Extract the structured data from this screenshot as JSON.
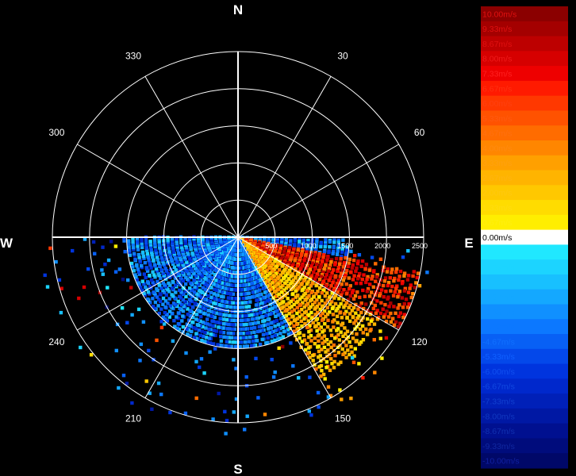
{
  "chart_data": {
    "type": "polar-radar",
    "title": "",
    "compass_labels": {
      "north": "N",
      "east": "E",
      "south": "S",
      "west": "W"
    },
    "bearing_labels": [
      {
        "deg": 30,
        "text": "30"
      },
      {
        "deg": 60,
        "text": "60"
      },
      {
        "deg": 120,
        "text": "120"
      },
      {
        "deg": 150,
        "text": "150"
      },
      {
        "deg": 210,
        "text": "210"
      },
      {
        "deg": 240,
        "text": "240"
      },
      {
        "deg": 300,
        "text": "300"
      },
      {
        "deg": 330,
        "text": "330"
      }
    ],
    "range_rings": [
      500,
      1000,
      1500,
      2000,
      2500
    ],
    "range_labels": [
      "500",
      "1000",
      "1500",
      "2000",
      "2500"
    ],
    "range_max": 2500,
    "spoke_interval_deg": 30,
    "data_sector_deg": [
      90,
      270
    ],
    "sector_summary": [
      {
        "bearing_from": 100,
        "bearing_to": 120,
        "velocity_range": [
          4.0,
          9.33
        ],
        "range_to": 2500
      },
      {
        "bearing_from": 120,
        "bearing_to": 150,
        "velocity_range": [
          0.67,
          4.67
        ],
        "range_to": 2200
      },
      {
        "bearing_from": 150,
        "bearing_to": 270,
        "velocity_range": [
          -6.67,
          -1.33
        ],
        "range_to": 1500
      }
    ],
    "colorscale": {
      "unit": "m/s",
      "entries": [
        {
          "value": 10.0,
          "label": "10.00m/s",
          "color": "#8b0000",
          "text_color": "#e01010"
        },
        {
          "value": 9.33,
          "label": "9.33m/s",
          "color": "#a40000",
          "text_color": "#e01010"
        },
        {
          "value": 8.67,
          "label": "8.67m/s",
          "color": "#bd0000",
          "text_color": "#e01010"
        },
        {
          "value": 8.0,
          "label": "8.00m/s",
          "color": "#d60000",
          "text_color": "#f01a1a"
        },
        {
          "value": 7.33,
          "label": "7.33m/s",
          "color": "#ee0000",
          "text_color": "#ff2020"
        },
        {
          "value": 6.67,
          "label": "6.67m/s",
          "color": "#ff1a00",
          "text_color": "#ff3010"
        },
        {
          "value": 6.0,
          "label": "6.00m/s",
          "color": "#ff3800",
          "text_color": "#ff4010"
        },
        {
          "value": 5.33,
          "label": "5.33m/s",
          "color": "#ff5200",
          "text_color": "#ff5a10"
        },
        {
          "value": 4.67,
          "label": "4.67m/s",
          "color": "#ff6c00",
          "text_color": "#ff7010"
        },
        {
          "value": 4.0,
          "label": "4.00m/s",
          "color": "#ff8600",
          "text_color": "#ff8a10"
        },
        {
          "value": 3.33,
          "label": "3.33m/s",
          "color": "#ffa000",
          "text_color": "#ffa010"
        },
        {
          "value": 2.67,
          "label": "2.67m/s",
          "color": "#ffb400",
          "text_color": "#ffb410"
        },
        {
          "value": 2.0,
          "label": "2.00m/s",
          "color": "#ffc800",
          "text_color": "#ffc810"
        },
        {
          "value": 1.33,
          "label": "1.33m/s",
          "color": "#ffdc00",
          "text_color": "#ffdc10"
        },
        {
          "value": 0.67,
          "label": "0.67m/s",
          "color": "#ffee00",
          "text_color": "#ffee10"
        },
        {
          "value": 0.0,
          "label": "0.00m/s",
          "color": "#ffffff",
          "text_color": "#ffffff"
        },
        {
          "value": -0.67,
          "label": "-0.67m/s",
          "color": "#20e8ff",
          "text_color": "#20e8ff"
        },
        {
          "value": -1.33,
          "label": "-1.33m/s",
          "color": "#1cd4ff",
          "text_color": "#1cd4ff"
        },
        {
          "value": -2.0,
          "label": "-2.00m/s",
          "color": "#18c0ff",
          "text_color": "#18c0ff"
        },
        {
          "value": -2.67,
          "label": "-2.67m/s",
          "color": "#14a8ff",
          "text_color": "#14a8ff"
        },
        {
          "value": -3.33,
          "label": "-3.33m/s",
          "color": "#1090ff",
          "text_color": "#1090ff"
        },
        {
          "value": -4.0,
          "label": "-4.00m/s",
          "color": "#0c78ff",
          "text_color": "#0c78ff"
        },
        {
          "value": -4.67,
          "label": "-4.67m/s",
          "color": "#0860f5",
          "text_color": "#1070ff"
        },
        {
          "value": -5.33,
          "label": "-5.33m/s",
          "color": "#0448ea",
          "text_color": "#1060ff"
        },
        {
          "value": -6.0,
          "label": "-6.00m/s",
          "color": "#0034de",
          "text_color": "#1050f0"
        },
        {
          "value": -6.67,
          "label": "-6.67m/s",
          "color": "#0028cc",
          "text_color": "#1048e0"
        },
        {
          "value": -7.33,
          "label": "-7.33m/s",
          "color": "#0020b8",
          "text_color": "#1040d0"
        },
        {
          "value": -8.0,
          "label": "-8.00m/s",
          "color": "#0018a4",
          "text_color": "#1038c0"
        },
        {
          "value": -8.67,
          "label": "-8.67m/s",
          "color": "#001090",
          "text_color": "#1030b0"
        },
        {
          "value": -9.33,
          "label": "-9.33m/s",
          "color": "#000c7c",
          "text_color": "#1028a0"
        },
        {
          "value": -10.0,
          "label": "-10.00m/s",
          "color": "#000868",
          "text_color": "#1020a0"
        }
      ]
    }
  }
}
